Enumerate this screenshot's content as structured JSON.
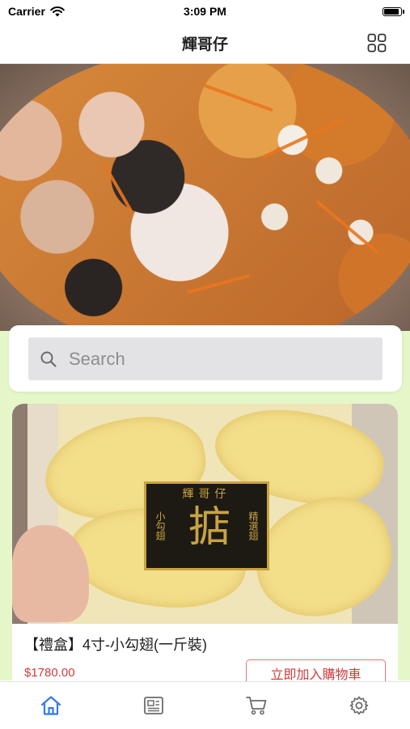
{
  "status_bar": {
    "carrier": "Carrier",
    "time": "3:09 PM"
  },
  "nav": {
    "title": "輝哥仔",
    "menu_icon": "grid-icon"
  },
  "search": {
    "placeholder": "Search",
    "value": ""
  },
  "product": {
    "name": "【禮盒】4寸-小勾翅(一斤裝)",
    "price": "$1780.00",
    "add_to_cart_label": "立即加入購物車",
    "package_label": {
      "title": "輝哥仔",
      "main_char": "掂",
      "side_left": "小勾翅",
      "side_right": "精選翅"
    }
  },
  "tab_bar": {
    "tabs": [
      {
        "icon": "home-icon",
        "active": true
      },
      {
        "icon": "news-icon",
        "active": false
      },
      {
        "icon": "cart-icon",
        "active": false
      },
      {
        "icon": "gear-icon",
        "active": false
      }
    ]
  },
  "colors": {
    "accent": "#3478f6",
    "price": "#d43a3a",
    "green_bg": "#e5f7c9",
    "button_border": "#e8757a"
  }
}
